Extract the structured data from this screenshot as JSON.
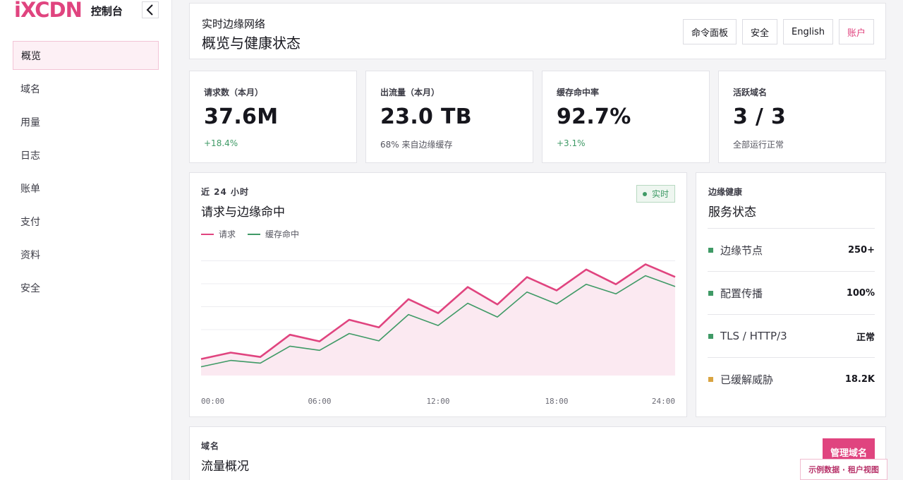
{
  "brand": {
    "logo": "iXCDN",
    "console": "控制台"
  },
  "sidebar": {
    "items": [
      {
        "label": "概览",
        "active": true
      },
      {
        "label": "域名"
      },
      {
        "label": "用量"
      },
      {
        "label": "日志"
      },
      {
        "label": "账单"
      },
      {
        "label": "支付"
      },
      {
        "label": "资料"
      },
      {
        "label": "安全"
      }
    ]
  },
  "header": {
    "subtitle": "实时边缘网络",
    "title": "概览与健康状态",
    "actions": [
      "命令面板",
      "安全",
      "English",
      "账户"
    ]
  },
  "stats": [
    {
      "label": "请求数（本月）",
      "value": "37.6M",
      "note": "+18.4%",
      "positive": true
    },
    {
      "label": "出流量（本月）",
      "value": "23.0 TB",
      "note": "68% 来自边缘缓存",
      "positive": false
    },
    {
      "label": "缓存命中率",
      "value": "92.7%",
      "note": "+3.1%",
      "positive": true
    },
    {
      "label": "活跃域名",
      "value": "3 / 3",
      "note": "全部运行正常",
      "positive": false
    }
  ],
  "traffic_chart": {
    "eyebrow": "近 24 小时",
    "title": "请求与边缘命中",
    "live_label": "实时",
    "legend": [
      {
        "name": "请求",
        "color": "#e0447f"
      },
      {
        "name": "缓存命中",
        "color": "#3f9a66"
      }
    ]
  },
  "chart_data": {
    "type": "line",
    "x": [
      "00:00",
      "02:00",
      "04:00",
      "06:00",
      "08:00",
      "10:00",
      "12:00",
      "14:00",
      "16:00",
      "18:00",
      "20:00",
      "22:00",
      "24:00"
    ],
    "tick_labels": [
      "00:00",
      "06:00",
      "12:00",
      "18:00",
      "24:00"
    ],
    "series": [
      {
        "name": "请求",
        "color": "#e0447f",
        "values": [
          0.72,
          1.0,
          0.81,
          1.78,
          1.49,
          2.43,
          2.1,
          3.33,
          2.72,
          3.86,
          3.1,
          4.29,
          3.71,
          4.62,
          3.98,
          4.85,
          4.3
        ]
      },
      {
        "name": "缓存命中",
        "color": "#3f9a66",
        "values": [
          0.38,
          0.66,
          0.54,
          1.28,
          1.1,
          1.83,
          1.51,
          2.66,
          2.18,
          3.15,
          2.55,
          3.64,
          3.12,
          3.98,
          3.56,
          4.35,
          3.88
        ]
      }
    ],
    "ylim": [
      0,
      6
    ],
    "grid": true,
    "legend": "top-left"
  },
  "health": {
    "eyebrow": "边缘健康",
    "title": "服务状态",
    "rows": [
      {
        "name": "边缘节点",
        "value": "250+",
        "color": "#3f9a66"
      },
      {
        "name": "配置传播",
        "value": "100%",
        "color": "#3f9a66"
      },
      {
        "name": "TLS / HTTP/3",
        "value": "正常",
        "color": "#3f9a66"
      },
      {
        "name": "已缓解威胁",
        "value": "18.2K",
        "color": "#d9a441"
      }
    ]
  },
  "domains": {
    "eyebrow": "域名",
    "title": "流量概况",
    "manage_label": "管理域名"
  },
  "demo_tag": "示例数据 · 租户视图",
  "colors": {
    "accent": "#e0447f",
    "success": "#3f9a66",
    "warning": "#d9a441"
  }
}
